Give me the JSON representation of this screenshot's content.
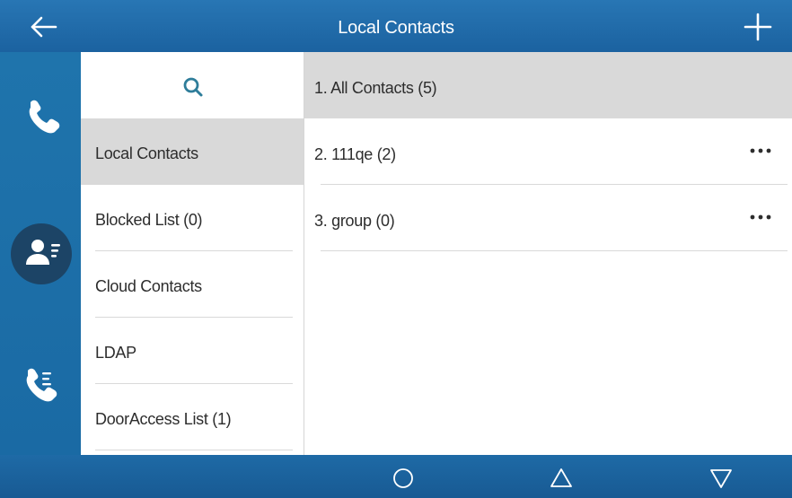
{
  "header": {
    "title": "Local Contacts",
    "back_icon": "arrow-left-icon",
    "add_icon": "plus-icon"
  },
  "left_rail": {
    "items": [
      {
        "name": "phone",
        "icon": "phone-icon",
        "active": false
      },
      {
        "name": "contacts",
        "icon": "contacts-icon",
        "active": true
      },
      {
        "name": "call-history",
        "icon": "call-history-icon",
        "active": false
      }
    ]
  },
  "nav": {
    "search_icon": "search-icon",
    "items": [
      {
        "label": "Local Contacts",
        "active": true
      },
      {
        "label": "Blocked List (0)",
        "active": false
      },
      {
        "label": "Cloud Contacts",
        "active": false
      },
      {
        "label": "LDAP",
        "active": false
      },
      {
        "label": "DoorAccess List (1)",
        "active": false
      }
    ]
  },
  "groups": {
    "items": [
      {
        "label": "1.  All Contacts (5)",
        "active": true,
        "has_more": false
      },
      {
        "label": "2.  111qe (2)",
        "active": false,
        "has_more": true
      },
      {
        "label": "3.  group (0)",
        "active": false,
        "has_more": true
      }
    ],
    "more_icon": "more-dots-icon"
  },
  "system_bar": {
    "home_icon": "circle-home-icon",
    "up_icon": "triangle-up-icon",
    "down_icon": "triangle-down-icon"
  },
  "colors": {
    "brand_blue": "#1b62a0",
    "accent_teal": "#2e7d9a",
    "selected_gray": "#d9d9d9",
    "active_rail_circle": "#1c4466"
  }
}
